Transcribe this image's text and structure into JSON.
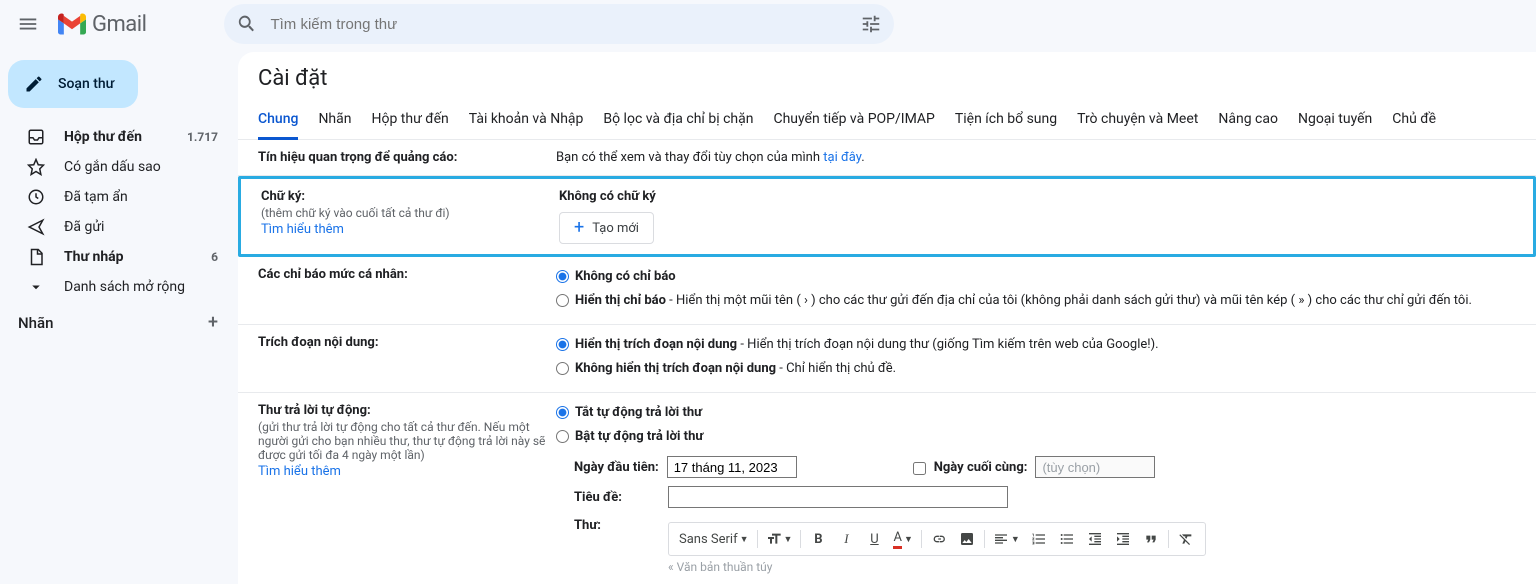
{
  "header": {
    "brand": "Gmail",
    "search_placeholder": "Tìm kiếm trong thư"
  },
  "sidebar": {
    "compose": "Soạn thư",
    "items": [
      {
        "label": "Hộp thư đến",
        "count": "1.717"
      },
      {
        "label": "Có gắn dấu sao",
        "count": ""
      },
      {
        "label": "Đã tạm ẩn",
        "count": ""
      },
      {
        "label": "Đã gửi",
        "count": ""
      },
      {
        "label": "Thư nháp",
        "count": "6"
      },
      {
        "label": "Danh sách mở rộng",
        "count": ""
      }
    ],
    "labels_header": "Nhãn"
  },
  "settings": {
    "title": "Cài đặt",
    "tabs": [
      "Chung",
      "Nhãn",
      "Hộp thư đến",
      "Tài khoản và Nhập",
      "Bộ lọc và địa chỉ bị chặn",
      "Chuyển tiếp và POP/IMAP",
      "Tiện ích bổ sung",
      "Trò chuyện và Meet",
      "Nâng cao",
      "Ngoại tuyến",
      "Chủ đề"
    ],
    "ad_signals": {
      "label": "Tín hiệu quan trọng để quảng cáo:",
      "text_before": "Bạn có thể xem và thay đổi tùy chọn của mình ",
      "link": "tại đây",
      "text_after": "."
    },
    "signature": {
      "label": "Chữ ký:",
      "sub": "(thêm chữ ký vào cuối tất cả thư đi)",
      "learn_more": "Tìm hiểu thêm",
      "no_signature": "Không có chữ ký",
      "create_new": "Tạo mới"
    },
    "personal_indicators": {
      "label": "Các chỉ báo mức cá nhân:",
      "opt1": "Không có chỉ báo",
      "opt2_bold": "Hiển thị chỉ báo",
      "opt2_desc": " - Hiển thị một mũi tên ( › ) cho các thư gửi đến địa chỉ của tôi (không phải danh sách gửi thư) và mũi tên kép ( » ) cho các thư chỉ gửi đến tôi."
    },
    "snippets": {
      "label": "Trích đoạn nội dung:",
      "opt1_bold": "Hiển thị trích đoạn nội dung",
      "opt1_desc": " - Hiển thị trích đoạn nội dung thư (giống Tìm kiếm trên web của Google!).",
      "opt2_bold": "Không hiển thị trích đoạn nội dung",
      "opt2_desc": " - Chỉ hiển thị chủ đề."
    },
    "vacation": {
      "label": "Thư trả lời tự động:",
      "sub": "(gửi thư trả lời tự động cho tất cả thư đến. Nếu một người gửi cho bạn nhiều thư, thư tự động trả lời này sẽ được gửi tối đa 4 ngày một lần)",
      "learn_more": "Tìm hiểu thêm",
      "opt_off": "Tắt tự động trả lời thư",
      "opt_on": "Bật tự động trả lời thư",
      "first_day_label": "Ngày đầu tiên:",
      "first_day_value": "17 tháng 11, 2023",
      "last_day_label": "Ngày cuối cùng:",
      "last_day_placeholder": "(tùy chọn)",
      "subject_label": "Tiêu đề:",
      "message_label": "Thư:",
      "font": "Sans Serif",
      "plain_text": "« Văn bản thuần túy"
    }
  }
}
